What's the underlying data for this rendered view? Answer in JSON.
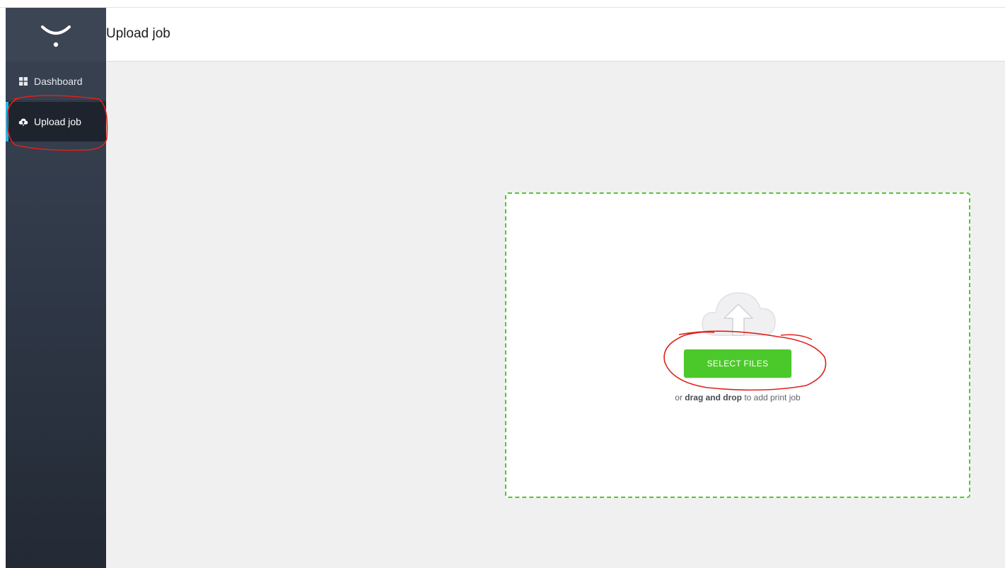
{
  "header": {
    "title": "Upload job"
  },
  "sidebar": {
    "items": [
      {
        "label": "Dashboard",
        "icon": "grid-icon"
      },
      {
        "label": "Upload job",
        "icon": "cloud-upload-icon"
      }
    ],
    "active_accent": "#2bb3e6"
  },
  "dropzone": {
    "button_label": "SELECT FILES",
    "prefix": "or",
    "emphasis": "drag and drop",
    "suffix": "to add print job",
    "accent": "#4cc92a"
  },
  "annotation_color": "#e0201b"
}
